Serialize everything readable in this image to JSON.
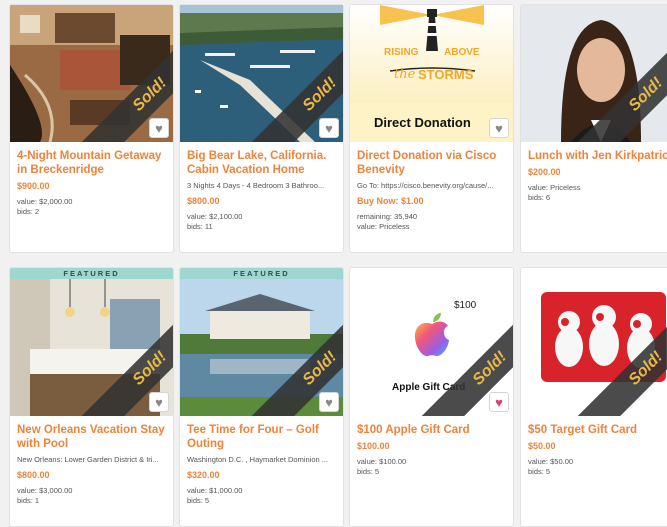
{
  "sold_label": "Sold!",
  "featured_label": "FEATURED",
  "cards": [
    {
      "title": "4-Night Mountain Getaway in Breckenridge",
      "subtitle": "",
      "price": "$900.00",
      "meta1": "value: $2,000.00",
      "meta2": "bids: 2"
    },
    {
      "title": "Big Bear Lake, California. Cabin Vacation Home",
      "subtitle": "3 Nights 4 Days - 4 Bedroom 3 Bathroo...",
      "price": "$800.00",
      "meta1": "value: $2,100.00",
      "meta2": "bids: 11"
    },
    {
      "title": "Direct Donation via Cisco Benevity",
      "subtitle": "Go To: https://cisco.benevity.org/cause/...",
      "price": "Buy Now: $1.00",
      "meta1": "remaining: 35,940",
      "meta2": "value: Priceless",
      "logo_line1a": "RISING",
      "logo_line1b": "ABOVE",
      "logo_line2": "the",
      "logo_line3": "STORMS",
      "banner": "Direct Donation"
    },
    {
      "title": "Lunch with Jen Kirkpatrick",
      "subtitle": "",
      "price": "$200.00",
      "meta1": "value: Priceless",
      "meta2": "bids: 6"
    },
    {
      "title": "New Orleans Vacation Stay with Pool",
      "subtitle": "New Orleans: Lower Garden District & Iri...",
      "price": "$800.00",
      "meta1": "value: $3,000.00",
      "meta2": "bids: 1"
    },
    {
      "title": "Tee Time for Four – Golf Outing",
      "subtitle": "Washington D.C. , Haymarket Dominion ...",
      "price": "$320.00",
      "meta1": "value: $1,000.00",
      "meta2": "bids: 5"
    },
    {
      "title": "$100 Apple Gift Card",
      "subtitle": "",
      "price": "$100.00",
      "meta1": "value: $100.00",
      "meta2": "bids: 5",
      "card_amount": "$100",
      "card_text": "Apple Gift Card"
    },
    {
      "title": "$50 Target Gift Card",
      "subtitle": "",
      "price": "$50.00",
      "meta1": "value: $50.00",
      "meta2": "bids: 5"
    }
  ],
  "icons": {
    "heart": "heart-icon",
    "apple": "apple-logo-icon",
    "lighthouse": "lighthouse-icon"
  },
  "colors": {
    "accent_orange": "#f0823a",
    "featured_teal": "#9fd6d0",
    "sold_text": "#e9b84a",
    "favorited_pink": "#e83a7a"
  }
}
